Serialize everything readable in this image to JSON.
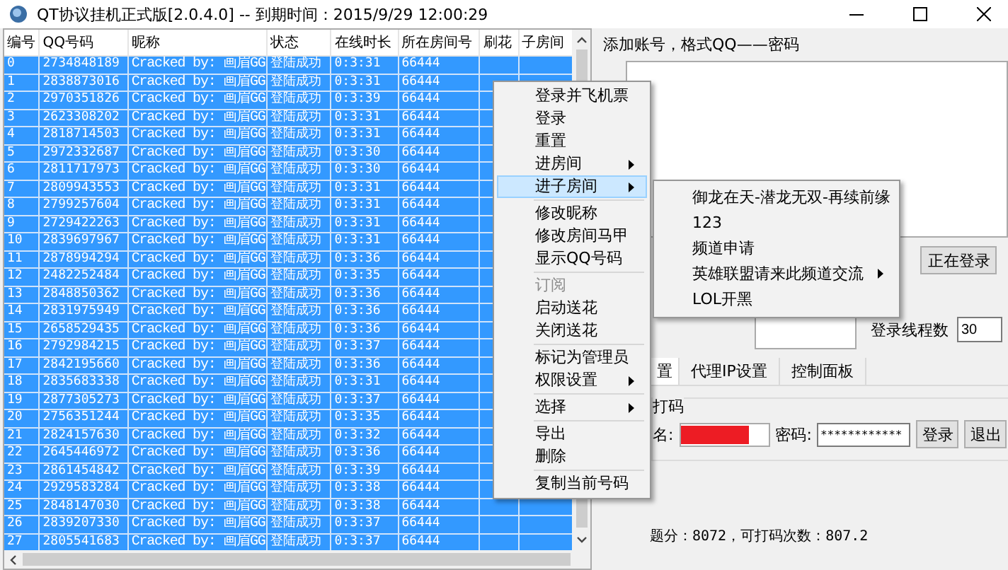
{
  "window": {
    "title": "QT协议挂机正式版[2.0.4.0] -- 到期时间：2015/9/29 12:00:29"
  },
  "table": {
    "columns": [
      "编号",
      "QQ号码",
      "昵称",
      "状态",
      "在线时长",
      "所在房间号",
      "刷花",
      "子房间"
    ],
    "rows": [
      {
        "cells": [
          "0",
          "2734848189",
          "Cracked by: 画眉GG",
          "登陆成功",
          "0:3:31",
          "66444"
        ],
        "selected": true
      },
      {
        "cells": [
          "1",
          "2838873016",
          "Cracked by: 画眉GG",
          "登陆成功",
          "0:3:31",
          "66444"
        ],
        "selected": true
      },
      {
        "cells": [
          "2",
          "2970351826",
          "Cracked by: 画眉GG",
          "登陆成功",
          "0:3:39",
          "66444"
        ],
        "selected": true
      },
      {
        "cells": [
          "3",
          "2623308202",
          "Cracked by: 画眉GG",
          "登陆成功",
          "0:3:31",
          "66444"
        ],
        "selected": true
      },
      {
        "cells": [
          "4",
          "2818714503",
          "Cracked by: 画眉GG",
          "登陆成功",
          "0:3:31",
          "66444"
        ],
        "selected": true
      },
      {
        "cells": [
          "5",
          "2972332687",
          "Cracked by: 画眉GG",
          "登陆成功",
          "0:3:30",
          "66444"
        ],
        "selected": true
      },
      {
        "cells": [
          "6",
          "2811717973",
          "Cracked by: 画眉GG",
          "登陆成功",
          "0:3:30",
          "66444"
        ],
        "selected": true
      },
      {
        "cells": [
          "7",
          "2809943553",
          "Cracked by: 画眉GG",
          "登陆成功",
          "0:3:31",
          "66444"
        ],
        "selected": true
      },
      {
        "cells": [
          "8",
          "2799257604",
          "Cracked by: 画眉GG",
          "登陆成功",
          "0:3:31",
          "66444"
        ],
        "selected": true
      },
      {
        "cells": [
          "9",
          "2729422263",
          "Cracked by: 画眉GG",
          "登陆成功",
          "0:3:31",
          "66444"
        ],
        "selected": true
      },
      {
        "cells": [
          "10",
          "2839697967",
          "Cracked by: 画眉GG",
          "登陆成功",
          "0:3:31",
          "66444"
        ],
        "selected": true
      },
      {
        "cells": [
          "11",
          "2878994294",
          "Cracked by: 画眉GG",
          "登陆成功",
          "0:3:36",
          "66444"
        ],
        "selected": true
      },
      {
        "cells": [
          "12",
          "2482252484",
          "Cracked by: 画眉GG",
          "登陆成功",
          "0:3:35",
          "66444"
        ],
        "selected": true
      },
      {
        "cells": [
          "13",
          "2848850362",
          "Cracked by: 画眉GG",
          "登陆成功",
          "0:3:36",
          "66444"
        ],
        "selected": true
      },
      {
        "cells": [
          "14",
          "2831975949",
          "Cracked by: 画眉GG",
          "登陆成功",
          "0:3:36",
          "66444"
        ],
        "selected": true
      },
      {
        "cells": [
          "15",
          "2658529435",
          "Cracked by: 画眉GG",
          "登陆成功",
          "0:3:36",
          "66444"
        ],
        "selected": true
      },
      {
        "cells": [
          "16",
          "2792984215",
          "Cracked by: 画眉GG",
          "登陆成功",
          "0:3:37",
          "66444"
        ],
        "selected": true
      },
      {
        "cells": [
          "17",
          "2842195660",
          "Cracked by: 画眉GG",
          "登陆成功",
          "0:3:36",
          "66444"
        ],
        "selected": true
      },
      {
        "cells": [
          "18",
          "2835683338",
          "Cracked by: 画眉GG",
          "登陆成功",
          "0:3:31",
          "66444"
        ],
        "selected": true
      },
      {
        "cells": [
          "19",
          "2877305273",
          "Cracked by: 画眉GG",
          "登陆成功",
          "0:3:37",
          "66444"
        ],
        "selected": true
      },
      {
        "cells": [
          "20",
          "2756351244",
          "Cracked by: 画眉GG",
          "登陆成功",
          "0:3:35",
          "66444"
        ],
        "selected": true
      },
      {
        "cells": [
          "21",
          "2824157630",
          "Cracked by: 画眉GG",
          "登陆成功",
          "0:3:32",
          "66444"
        ],
        "selected": true
      },
      {
        "cells": [
          "22",
          "2645446972",
          "Cracked by: 画眉GG",
          "登陆成功",
          "0:3:36",
          "66444"
        ],
        "selected": true
      },
      {
        "cells": [
          "23",
          "2861454842",
          "Cracked by: 画眉GG",
          "登陆成功",
          "0:3:39",
          "66444"
        ],
        "selected": true
      },
      {
        "cells": [
          "24",
          "2929583284",
          "Cracked by: 画眉GG",
          "登陆成功",
          "0:3:38",
          "66444"
        ],
        "selected": true
      },
      {
        "cells": [
          "25",
          "2848147030",
          "Cracked by: 画眉GG",
          "登陆成功",
          "0:3:38",
          "66444"
        ],
        "selected": true
      },
      {
        "cells": [
          "26",
          "2839207330",
          "Cracked by: 画眉GG",
          "登陆成功",
          "0:3:37",
          "66444"
        ],
        "selected": true
      },
      {
        "cells": [
          "27",
          "2805541683",
          "Cracked by: 画眉GG",
          "登陆成功",
          "0:3:37",
          "66444"
        ],
        "selected": true
      }
    ]
  },
  "context_menu": {
    "items": [
      {
        "kind": "item",
        "label": "登录并飞机票",
        "submenu": false,
        "disabled": false,
        "selected": false
      },
      {
        "kind": "item",
        "label": "登录",
        "submenu": false,
        "disabled": false,
        "selected": false
      },
      {
        "kind": "item",
        "label": "重置",
        "submenu": false,
        "disabled": false,
        "selected": false
      },
      {
        "kind": "item",
        "label": "进房间",
        "submenu": true,
        "disabled": false,
        "selected": false
      },
      {
        "kind": "item",
        "label": "进子房间",
        "submenu": true,
        "disabled": false,
        "selected": true
      },
      {
        "kind": "separator"
      },
      {
        "kind": "item",
        "label": "修改昵称",
        "submenu": false,
        "disabled": false,
        "selected": false
      },
      {
        "kind": "item",
        "label": "修改房间马甲",
        "submenu": false,
        "disabled": false,
        "selected": false
      },
      {
        "kind": "item",
        "label": "显示QQ号码",
        "submenu": false,
        "disabled": false,
        "selected": false
      },
      {
        "kind": "separator"
      },
      {
        "kind": "item",
        "label": "订阅",
        "submenu": false,
        "disabled": true,
        "selected": false
      },
      {
        "kind": "item",
        "label": "启动送花",
        "submenu": false,
        "disabled": false,
        "selected": false
      },
      {
        "kind": "item",
        "label": "关闭送花",
        "submenu": false,
        "disabled": false,
        "selected": false
      },
      {
        "kind": "separator"
      },
      {
        "kind": "item",
        "label": "标记为管理员",
        "submenu": false,
        "disabled": false,
        "selected": false
      },
      {
        "kind": "item",
        "label": "权限设置",
        "submenu": true,
        "disabled": false,
        "selected": false
      },
      {
        "kind": "separator"
      },
      {
        "kind": "item",
        "label": "选择",
        "submenu": true,
        "disabled": false,
        "selected": false
      },
      {
        "kind": "separator"
      },
      {
        "kind": "item",
        "label": "导出",
        "submenu": false,
        "disabled": false,
        "selected": false
      },
      {
        "kind": "item",
        "label": "删除",
        "submenu": false,
        "disabled": false,
        "selected": false
      },
      {
        "kind": "separator"
      },
      {
        "kind": "item",
        "label": "复制当前号码",
        "submenu": false,
        "disabled": false,
        "selected": false
      }
    ]
  },
  "submenu": {
    "items": [
      {
        "label": "御龙在天-潜龙无双-再续前缘",
        "submenu": false
      },
      {
        "label": "123",
        "submenu": false
      },
      {
        "label": "频道申请",
        "submenu": false
      },
      {
        "label": "英雄联盟请来此频道交流",
        "submenu": true
      },
      {
        "label": "LOL开黑",
        "submenu": false
      }
    ]
  },
  "right_panel": {
    "account_label": "添加账号，格式QQ——密码",
    "login_button": "正在登录",
    "threads_label": "登录线程数",
    "threads_value": "30",
    "tabs": [
      {
        "label": "置",
        "selected": true
      },
      {
        "label": "代理IP设置",
        "selected": false
      },
      {
        "label": "控制面板",
        "selected": false
      }
    ],
    "captcha": {
      "title": "打码",
      "user_label": "名:",
      "user_redacted": true,
      "password_label": "密码:",
      "password_value": "************",
      "buttons": [
        "登录",
        "退出"
      ],
      "balance": "题分：8072，可打码次数：807.2"
    }
  }
}
